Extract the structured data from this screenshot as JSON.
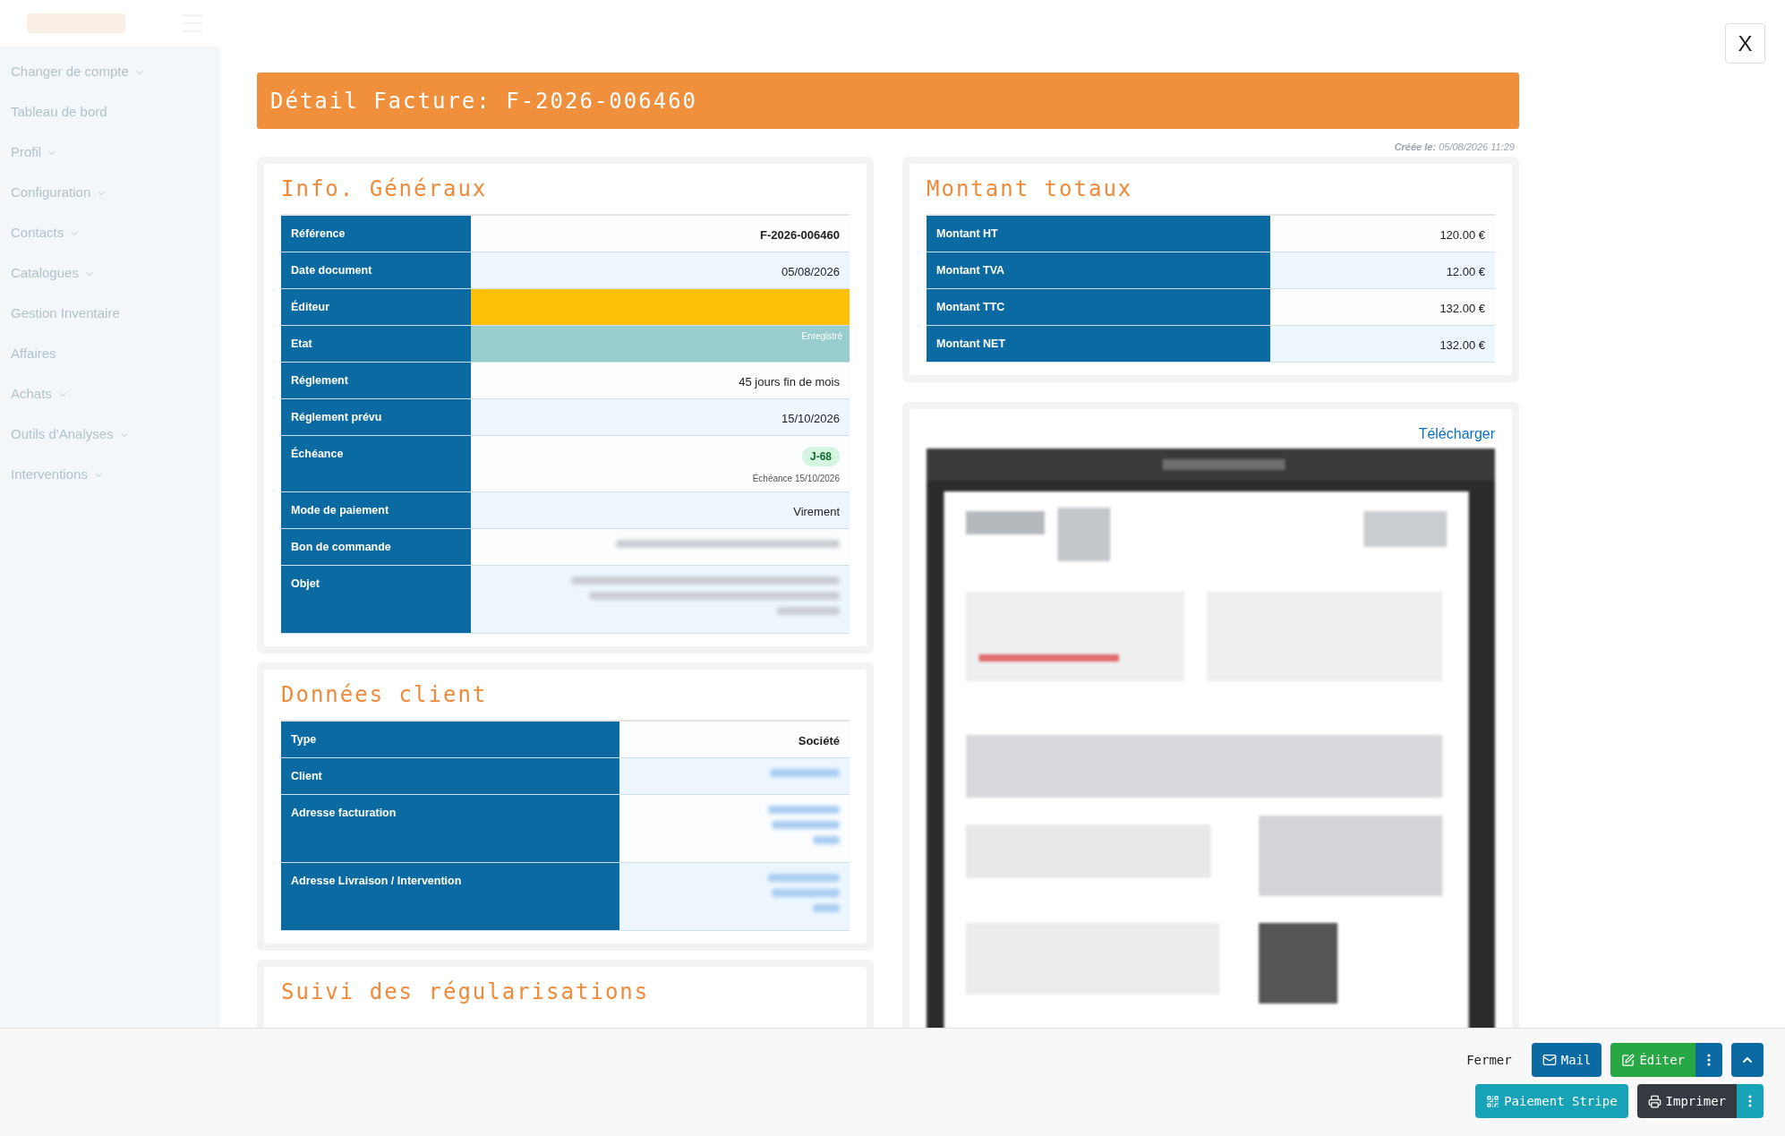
{
  "sidebar": {
    "items": [
      {
        "label": "Changer de compte",
        "caret": true
      },
      {
        "label": "Tableau de bord",
        "caret": false
      },
      {
        "label": "Profil",
        "caret": true
      },
      {
        "label": "Configuration",
        "caret": true
      },
      {
        "label": "Contacts",
        "caret": true
      },
      {
        "label": "Catalogues",
        "caret": true
      },
      {
        "label": "Gestion Inventaire",
        "caret": false
      },
      {
        "label": "Affaires",
        "caret": false
      },
      {
        "label": "Achats",
        "caret": true
      },
      {
        "label": "Outils d'Analyses",
        "caret": true
      },
      {
        "label": "Interventions",
        "caret": true
      }
    ]
  },
  "modal": {
    "title": "Détail Facture: F-2026-006460",
    "close": "X",
    "created": "**Créée le:** 05/08/2026 11:29",
    "info": {
      "title": "Info. Généraux",
      "rows": [
        {
          "label": "Référence",
          "kind": "bold",
          "value": "F-2026-006460"
        },
        {
          "label": "Date document",
          "kind": "text",
          "value": "05/08/2026"
        },
        {
          "label": "Éditeur",
          "kind": "status",
          "color": "#ffc107"
        },
        {
          "label": "Etat",
          "kind": "status",
          "color": "#99cccc",
          "value": "Enregistré"
        },
        {
          "label": "Réglement",
          "kind": "text",
          "value": "45 jours fin de mois"
        },
        {
          "label": "Réglement prévu",
          "kind": "text",
          "value": "15/10/2026"
        },
        {
          "label": "Échéance",
          "kind": "deadline",
          "badge": "J-68",
          "value": "Échéance 15/10/2026"
        },
        {
          "label": "Mode de paiement",
          "kind": "text",
          "value": "Virement"
        },
        {
          "label": "Bon de commande",
          "kind": "redacted_line"
        },
        {
          "label": "Objet",
          "kind": "redacted_block"
        }
      ]
    },
    "client": {
      "title": "Données client",
      "rows": [
        {
          "label": "Type",
          "kind": "bold",
          "value": "Société"
        },
        {
          "label": "Client",
          "kind": "redacted_link_line"
        },
        {
          "label": "Adresse facturation",
          "kind": "redacted_link_block"
        },
        {
          "label": "Adresse Livraison / Intervention",
          "kind": "redacted_link_block"
        }
      ]
    },
    "regularisations": {
      "title": "Suivi des régularisations"
    },
    "totals": {
      "title": "Montant totaux",
      "rows": [
        {
          "label": "Montant HT",
          "value": "120.00 €"
        },
        {
          "label": "Montant TVA",
          "value": "12.00 €"
        },
        {
          "label": "Montant TTC",
          "value": "132.00 €"
        },
        {
          "label": "Montant NET",
          "value": "132.00 €"
        }
      ]
    },
    "document": {
      "download": "Télécharger"
    },
    "footer": {
      "primary_actions": [
        {
          "kind": "link",
          "label": "Fermer",
          "menu": false
        },
        {
          "kind": "mail",
          "label": "Mail",
          "menu": false
        },
        {
          "kind": "edit",
          "label": "Éditer",
          "menu": true
        },
        {
          "kind": "collapse"
        }
      ],
      "secondary_actions": [
        {
          "kind": "stripe",
          "label": "Paiement Stripe",
          "menu": false
        },
        {
          "kind": "print",
          "label": "Imprimer",
          "menu": true
        }
      ]
    }
  }
}
